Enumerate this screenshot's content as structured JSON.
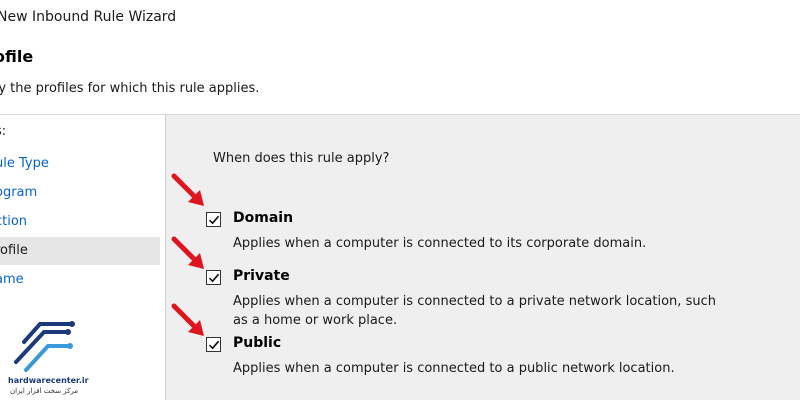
{
  "window": {
    "title": "New Inbound Rule Wizard"
  },
  "page": {
    "heading": "ofile",
    "subheading": "fy the profiles for which this rule applies."
  },
  "steps": [
    {
      "label": "s:",
      "state": "header"
    },
    {
      "label": "ule Type",
      "state": "link"
    },
    {
      "label": "ogram",
      "state": "link"
    },
    {
      "label": "ction",
      "state": "link"
    },
    {
      "label": "rofile",
      "state": "current"
    },
    {
      "label": "ame",
      "state": "link"
    }
  ],
  "content": {
    "question": "When does this rule apply?",
    "options": [
      {
        "label": "Domain",
        "checked": true,
        "description": "Applies when a computer is connected to its corporate domain."
      },
      {
        "label": "Private",
        "checked": true,
        "description": "Applies when a computer is connected to a private network location, such as a home or work place."
      },
      {
        "label": "Public",
        "checked": true,
        "description": "Applies when a computer is connected to a public network location."
      }
    ]
  },
  "watermark": {
    "name": "hardwarecenter.ir",
    "subtitle": "مرکز سخت افزار ایران"
  },
  "colors": {
    "accent_arrow": "#e0141e",
    "link": "#0a64c8",
    "content_bg": "#efefef"
  }
}
